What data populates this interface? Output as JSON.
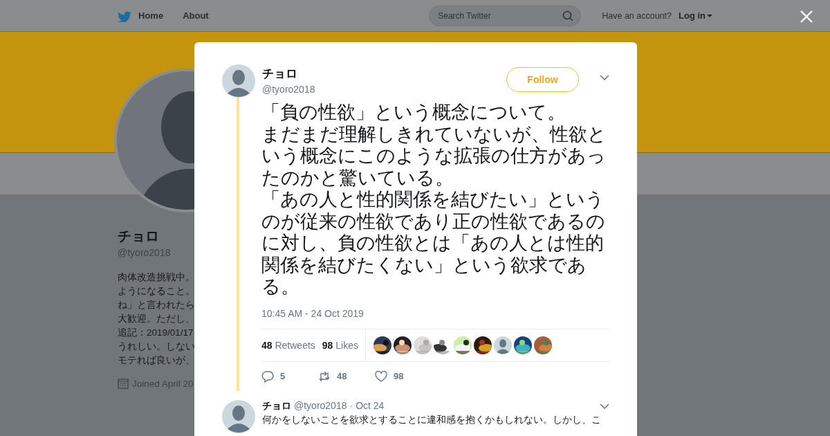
{
  "navbar": {
    "links": [
      "Home",
      "About"
    ],
    "search": {
      "placeholder": "Search Twitter"
    },
    "account_prompt": "Have an account?",
    "login": "Log in"
  },
  "profile": {
    "name": "チョロ",
    "handle": "@tyoro2018",
    "bio_lines": [
      "肉体改造挑戦中。",
      "ようになること。",
      "ね」と言われたら",
      "大歓迎。ただし、",
      "追記：2019/01/17",
      "うれしい。しない",
      "モテれば良いが、"
    ],
    "joined": "Joined April 20"
  },
  "tweet": {
    "name": "チョロ",
    "handle": "@tyoro2018",
    "follow": "Follow",
    "paragraphs": [
      "「負の性欲」という概念について。",
      "まだまだ理解しきれていないが、性欲という概念にこのような拡張の仕方があったのかと驚いている。",
      "「あの人と性的関係を結びたい」というのが従来の性欲であり正の性欲であるのに対し、負の性欲とは「あの人とは性的関係を結びたくない」という欲求である。"
    ],
    "timestamp": "10:45 AM - 24 Oct 2019",
    "stats": [
      {
        "count": "48",
        "label": "Retweets"
      },
      {
        "count": "98",
        "label": "Likes"
      }
    ],
    "likers": [
      {
        "kind": "picture"
      },
      {
        "kind": "picture"
      },
      {
        "kind": "picture"
      },
      {
        "kind": "picture"
      },
      {
        "kind": "picture"
      },
      {
        "kind": "picture"
      },
      {
        "kind": "default"
      },
      {
        "kind": "picture"
      },
      {
        "kind": "picture"
      }
    ],
    "actions": [
      {
        "kind": "reply",
        "count": "5"
      },
      {
        "kind": "retweet",
        "count": "48"
      },
      {
        "kind": "like",
        "count": "98"
      }
    ]
  },
  "reply": {
    "name": "チョロ",
    "handle": "@tyoro2018",
    "separator": "·",
    "date": "Oct 24",
    "text": "何かをしないことを欲求とすることに違和感を抱くかもしれない。しかし、こ"
  }
}
